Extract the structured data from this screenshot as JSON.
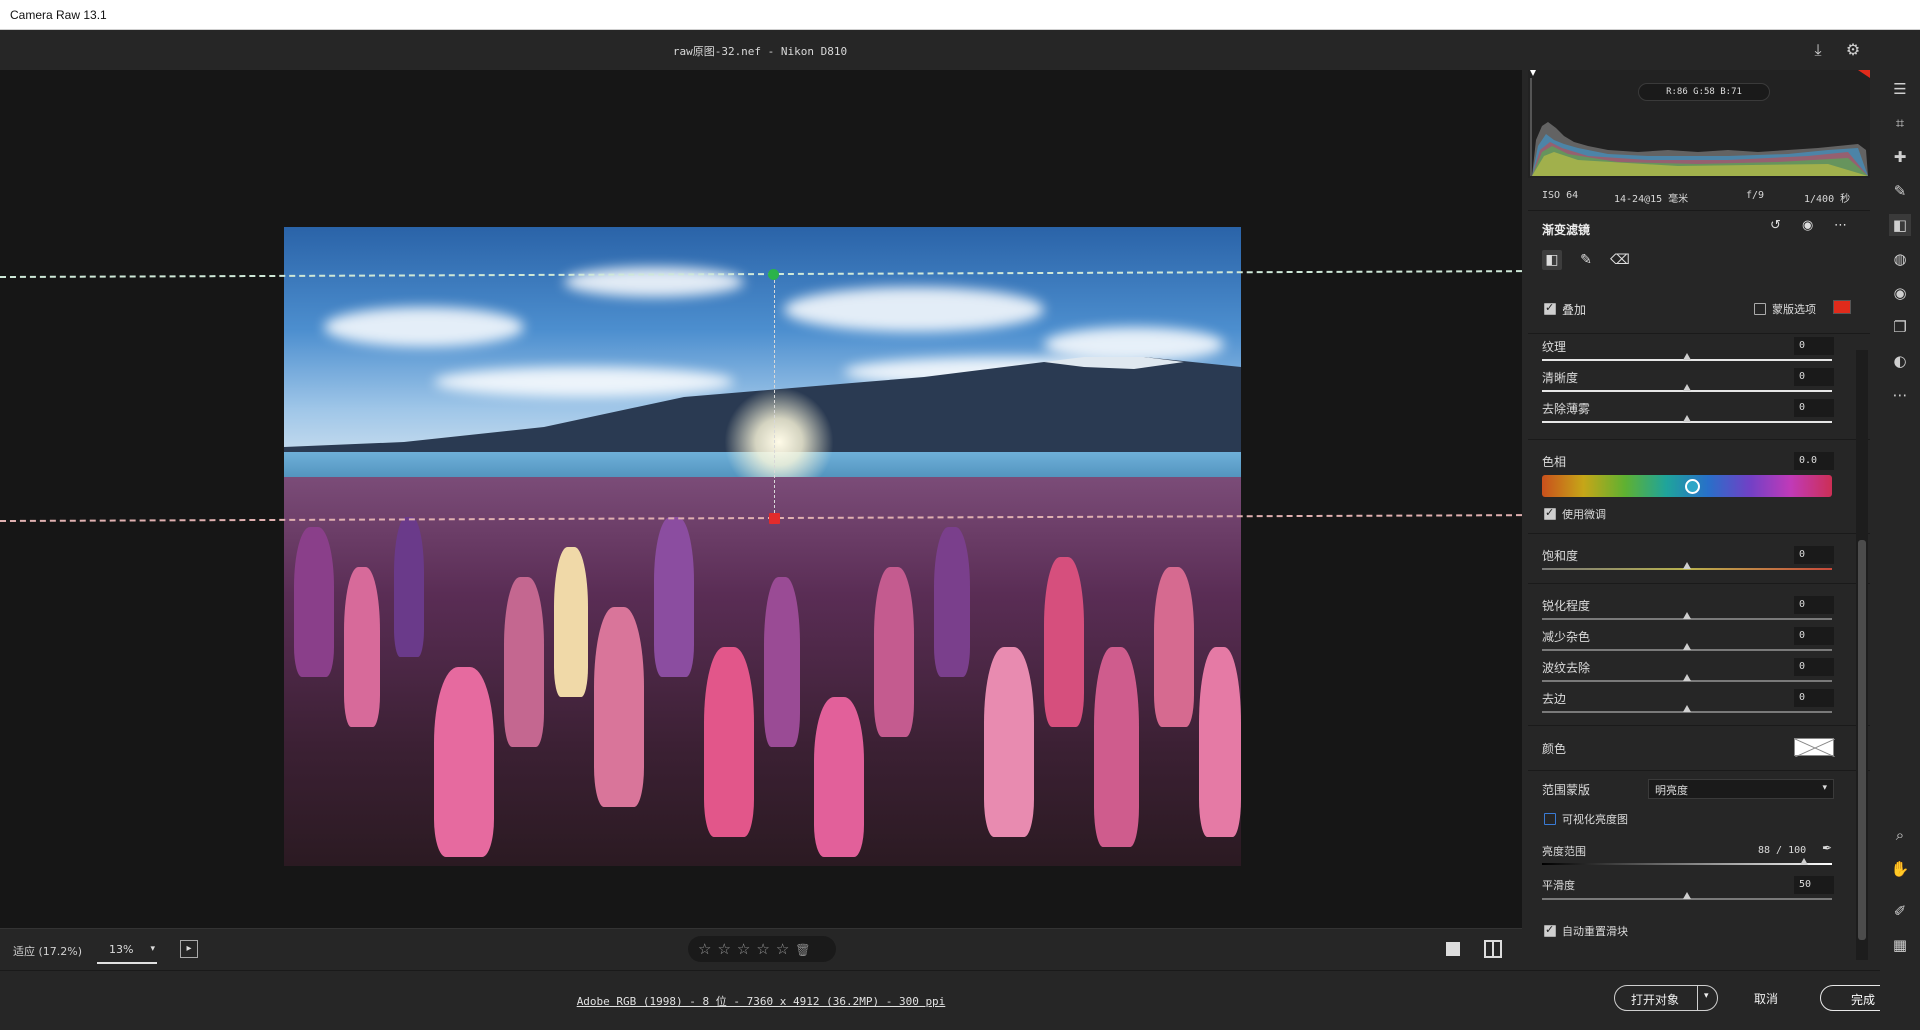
{
  "app": {
    "title": "Camera Raw 13.1"
  },
  "header": {
    "file_title": "raw原图-32.nef  -  Nikon D810"
  },
  "bottom_bar": {
    "fit_label": "适应 (17.2%)",
    "zoom_value": "13%"
  },
  "footer": {
    "info_link": "Adobe RGB (1998) - 8 位 - 7360 x 4912 (36.2MP) - 300 ppi",
    "open_label": "打开对象",
    "cancel_label": "取消",
    "done_label": "完成"
  },
  "histogram": {
    "rgb_readout": "R:86  G:58  B:71",
    "exif": {
      "iso": "ISO 64",
      "lens": "14-24@15 毫米",
      "aperture": "f/9",
      "shutter": "1/400 秒"
    }
  },
  "panel": {
    "section_title": "渐变滤镜",
    "overlay_label": "叠加",
    "mask_options_label": "蒙版选项",
    "mask_color": "#e02b1b",
    "sliders_a": [
      {
        "label": "纹理",
        "value": "0"
      },
      {
        "label": "清晰度",
        "value": "0"
      },
      {
        "label": "去除薄雾",
        "value": "0"
      }
    ],
    "hue": {
      "label": "色相",
      "value": "0.0",
      "fine_tune_label": "使用微调"
    },
    "saturation": {
      "label": "饱和度",
      "value": "0"
    },
    "sliders_b": [
      {
        "label": "锐化程度",
        "value": "0"
      },
      {
        "label": "减少杂色",
        "value": "0"
      },
      {
        "label": "波纹去除",
        "value": "0"
      },
      {
        "label": "去边",
        "value": "0"
      }
    ],
    "color_label": "颜色",
    "range_mask_label": "范围蒙版",
    "range_mask_value": "明亮度",
    "visualize_label": "可视化亮度图",
    "luminance_range_label": "亮度范围",
    "luminance_range_value": "88 / 100",
    "smoothness_label": "平滑度",
    "smoothness_value": "50",
    "auto_reset_label": "自动重置滑块"
  },
  "icons": {
    "save": "download-icon",
    "settings": "gear-icon",
    "fullscreen": "expand-icon",
    "rail": [
      "edit-sliders-icon",
      "crop-icon",
      "healing-icon",
      "brush-icon",
      "gradient-icon",
      "radial-icon",
      "redeye-icon",
      "snapshots-icon",
      "presets-icon",
      "more-icon",
      "zoom-icon",
      "hand-icon",
      "sampler-icon",
      "grid-icon"
    ]
  }
}
